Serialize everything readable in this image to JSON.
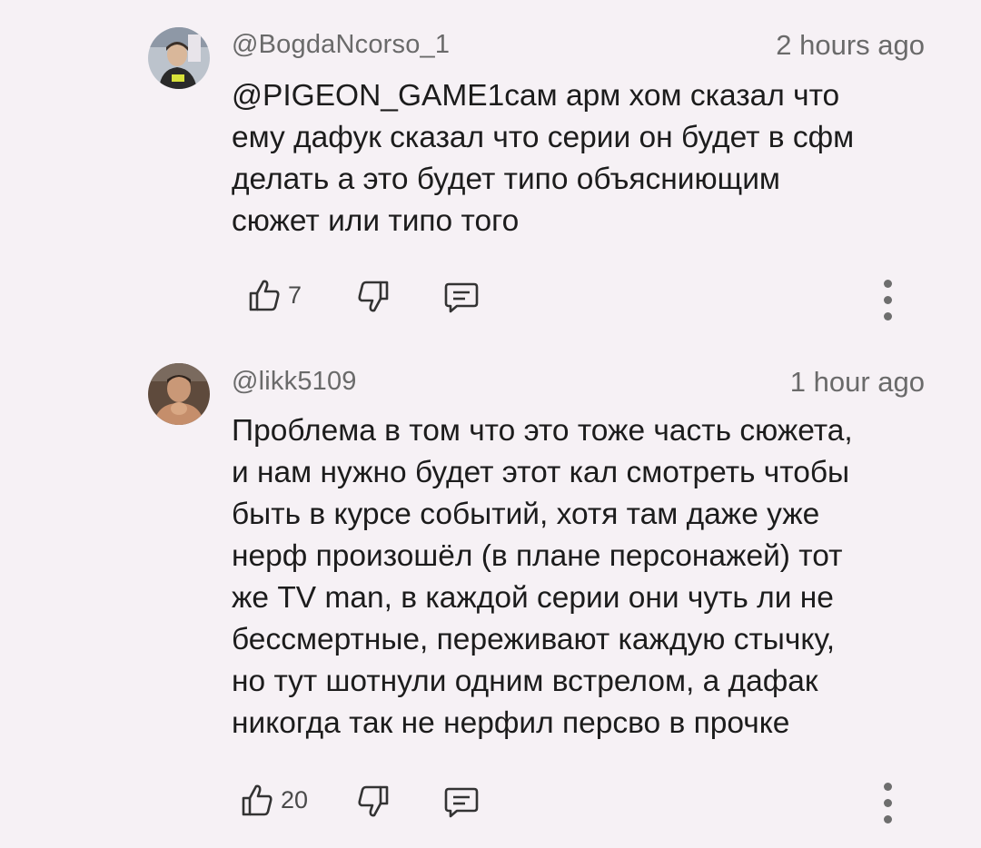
{
  "comments": [
    {
      "handle": "@BogdaNcorso_1",
      "time": "2 hours ago",
      "lines": [
        "@PIGEON_GAME1сам арм хом сказал что",
        "ему дафук сказал что серии он будет в сфм",
        "делать а это будет типо объясниющим",
        "сюжет или типо того"
      ],
      "likes": "7",
      "avatar_icon": "user-avatar-boy",
      "colors": {
        "avatar_bg": "#b9c0c8"
      }
    },
    {
      "handle": "@likk5109",
      "time": "1 hour ago",
      "lines": [
        "Проблема в том что это тоже часть сюжета,",
        "и нам нужно будет этот кал смотреть чтобы",
        "быть в курсе событий, хотя там даже уже",
        "нерф произошёл (в плане персонажей) тот",
        "же TV man, в каждой серии они чуть ли не",
        "бессмертные, переживают каждую стычку,",
        "но тут шотнули одним встрелом, а дафак",
        "никогда так не нерфил персво в прочке"
      ],
      "likes": "20",
      "avatar_icon": "user-avatar-man",
      "colors": {
        "avatar_bg": "#8a6a52"
      }
    }
  ],
  "icons": {
    "like": "thumbs-up-icon",
    "dislike": "thumbs-down-icon",
    "reply": "reply-comment-icon",
    "more": "more-vertical-icon"
  },
  "colors": {
    "background": "#f6f1f5",
    "text": "#1c1c1c",
    "meta": "#6a6a6a"
  }
}
